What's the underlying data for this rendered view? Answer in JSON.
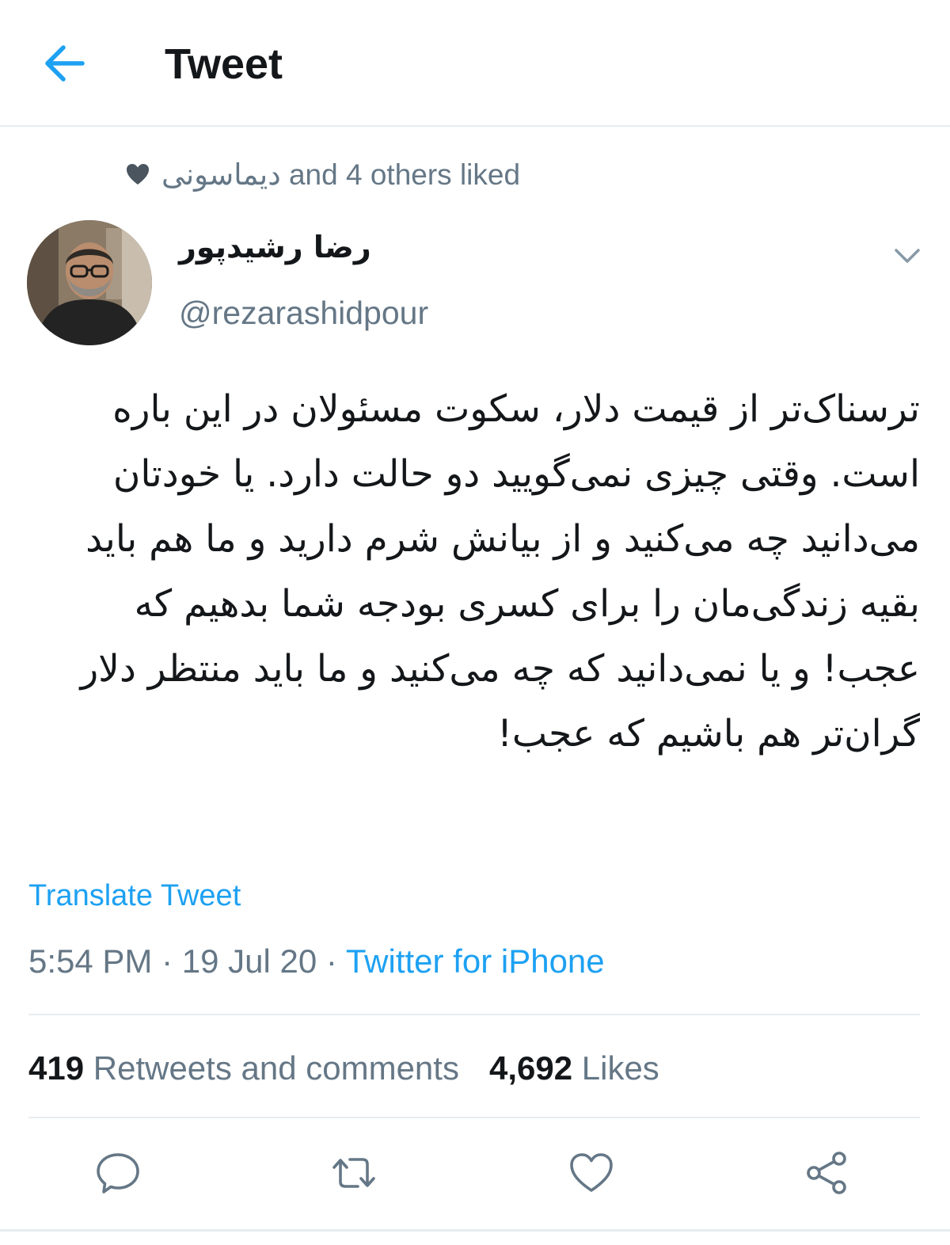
{
  "header": {
    "title": "Tweet",
    "back_icon": "arrow-left-icon",
    "accent_color": "#1da1f2"
  },
  "social_context": {
    "icon": "heart-filled-icon",
    "text": "دیماسونی and 4 others liked"
  },
  "author": {
    "display_name": "رضا رشیدپور",
    "handle": "@rezarashidpour",
    "menu_icon": "chevron-down-icon"
  },
  "tweet": {
    "text": "ترسناک‌تر از قیمت دلار، سکوت مسئولان در این باره است. وقتی چیزی نمی‌گویید دو حالت دارد. یا خودتان می‌دانید چه می‌کنید و از بیانش شرم دارید و ما هم باید بقیه زندگی‌مان را برای کسری بودجه شما بدهیم که عجب! و یا نمی‌دانید که چه می‌کنید و ما باید منتظر دلار گران‌تر هم باشیم که عجب!",
    "translate_label": "Translate Tweet",
    "time": "5:54 PM",
    "date": "19 Jul 20",
    "separator": "·",
    "source": "Twitter for iPhone"
  },
  "stats": {
    "retweets_count": "419",
    "retweets_label": "Retweets and comments",
    "likes_count": "4,692",
    "likes_label": "Likes"
  },
  "actions": [
    {
      "icon": "reply-icon"
    },
    {
      "icon": "retweet-icon"
    },
    {
      "icon": "like-icon"
    },
    {
      "icon": "share-icon"
    }
  ],
  "colors": {
    "text_primary": "#14171a",
    "text_secondary": "#657786",
    "link": "#1da1f2",
    "divider": "#e6ecf0"
  }
}
